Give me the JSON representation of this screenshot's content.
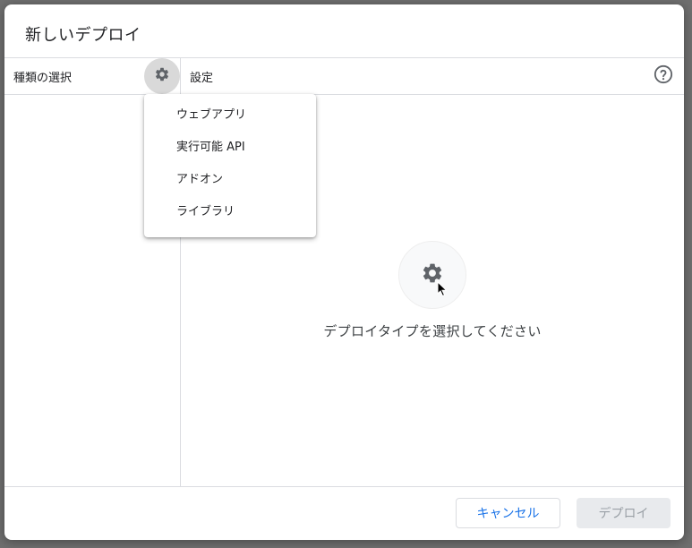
{
  "dialog": {
    "title": "新しいデプロイ"
  },
  "left_panel": {
    "header_label": "種類の選択",
    "settings_icon": "gear-icon"
  },
  "right_panel": {
    "header_label": "設定",
    "help_icon": "help-circle-icon",
    "placeholder_icon": "gear-icon",
    "placeholder_text": "デプロイタイプを選択してください"
  },
  "type_menu": {
    "items": [
      {
        "label": "ウェブアプリ"
      },
      {
        "label": "実行可能 API"
      },
      {
        "label": "アドオン"
      },
      {
        "label": "ライブラリ"
      }
    ]
  },
  "footer": {
    "cancel_label": "キャンセル",
    "deploy_label": "デプロイ"
  },
  "colors": {
    "accent": "#1a73e8",
    "disabled_bg": "#e8eaed",
    "disabled_text": "#9aa0a6",
    "overlay": "#6f6f6f"
  }
}
